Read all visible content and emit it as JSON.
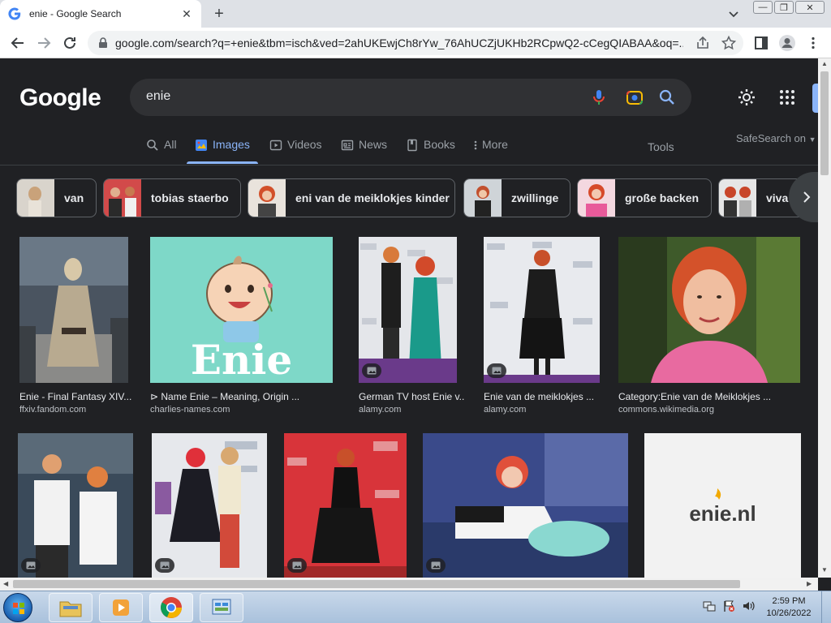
{
  "browser": {
    "tab_title": "enie - Google Search",
    "url": "google.com/search?q=+enie&tbm=isch&ved=2ahUKEwjCh8rYw_76AhUCZjUKHb2RCpwQ2-cCegQIABAA&oq=..."
  },
  "google": {
    "logo": "Google",
    "query": "enie",
    "tabs": [
      {
        "label": "All",
        "icon": "search-icon"
      },
      {
        "label": "Images",
        "icon": "image-icon"
      },
      {
        "label": "Videos",
        "icon": "video-icon"
      },
      {
        "label": "News",
        "icon": "news-icon"
      },
      {
        "label": "Books",
        "icon": "book-icon"
      },
      {
        "label": "More",
        "icon": "more-vert-icon"
      }
    ],
    "active_tab": "Images",
    "tools_label": "Tools",
    "safesearch_label": "SafeSearch on",
    "chips": [
      "van",
      "tobias staerbo",
      "eni van de meiklokjes kinder",
      "zwillinge",
      "große backen",
      "viva"
    ],
    "results_row1": [
      {
        "caption": "Enie - Final Fantasy XIV...",
        "source": "ffxiv.fandom.com"
      },
      {
        "caption": "⊳ Name Enie – Meaning, Origin ...",
        "source": "charlies-names.com",
        "image_text": "Enie"
      },
      {
        "caption": "German TV host Enie v...",
        "source": "alamy.com"
      },
      {
        "caption": "Enie van de meiklokjes ...",
        "source": "alamy.com"
      },
      {
        "caption": "Category:Enie van de Meiklokjes ...",
        "source": "commons.wikimedia.org"
      }
    ],
    "results_row2": [
      {
        "caption": "",
        "source": ""
      },
      {
        "caption": "",
        "source": ""
      },
      {
        "caption": "",
        "source": ""
      },
      {
        "caption": "",
        "source": ""
      },
      {
        "caption": "",
        "source": "",
        "image_text": "enie.nl"
      }
    ]
  },
  "taskbar": {
    "time": "2:59 PM",
    "date": "10/26/2022"
  },
  "colors": {
    "page_bg": "#202124",
    "accent": "#8ab4f8",
    "text": "#e8eaed",
    "muted": "#9aa0a6",
    "searchbox": "#303134"
  }
}
